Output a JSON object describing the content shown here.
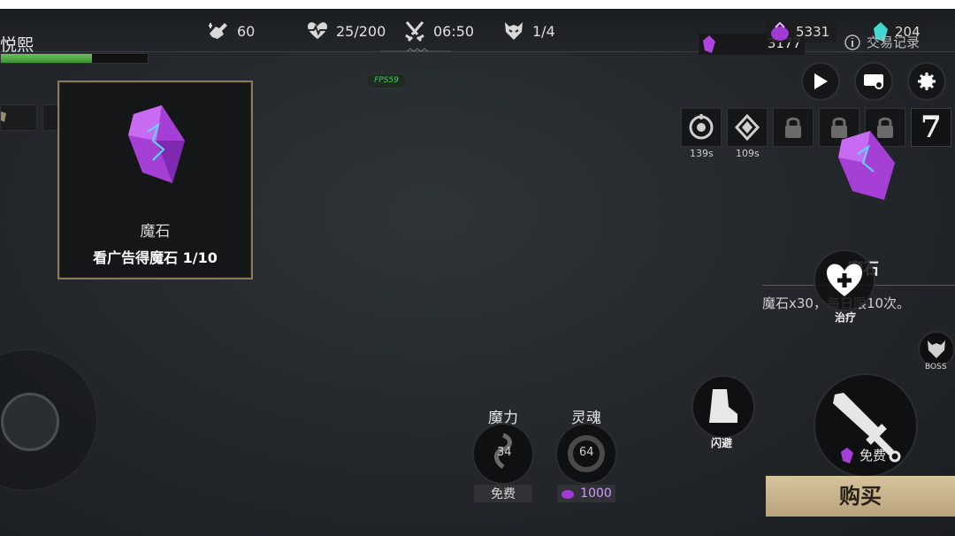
{
  "player": {
    "name": "悦熙",
    "hp_fraction": 0.62
  },
  "top_stats": {
    "attack": "60",
    "health": "25/200",
    "timer": "06:50",
    "wave": "1/4"
  },
  "fps_label": "FPS59",
  "currency": {
    "magic_stone": "5331",
    "soul_crystal": "204",
    "magic_stone_secondary": "3177",
    "trade_record": "交易记录"
  },
  "skill_slots": [
    {
      "cooldown": "139s"
    },
    {
      "cooldown": "109s"
    },
    {
      "cooldown": ""
    },
    {
      "cooldown": ""
    },
    {
      "cooldown": ""
    }
  ],
  "level": "7",
  "popup": {
    "item_name": "魔石",
    "description": "看广告得魔石 1/10"
  },
  "side_item": {
    "name": "魔石",
    "description": "魔石x30，每日限10次。"
  },
  "actions": {
    "heal": "治疗",
    "dodge": "闪避",
    "boss": "BOSS",
    "attack": "攻击",
    "free": "免费",
    "buy": "购买"
  },
  "resources": {
    "mana_label": "魔力",
    "mana_value": "34",
    "mana_cost": "免费",
    "soul_label": "灵魂",
    "soul_value": "64",
    "soul_cost": "1000"
  },
  "colors": {
    "accent_gold": "#d7c49d",
    "crystal_purple": "#b044e0",
    "hp_green": "#4caf3f",
    "fps_green": "#39d65b"
  }
}
